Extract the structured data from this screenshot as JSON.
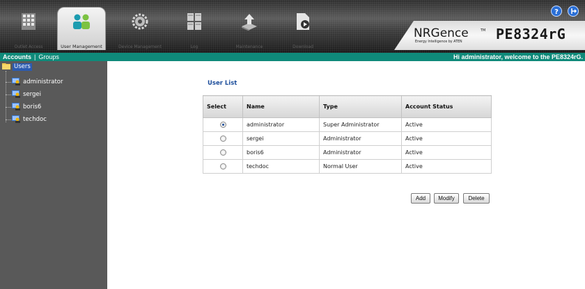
{
  "nav": {
    "tabs": [
      {
        "label": "Outlet Access",
        "icon": "outlet-grid-icon",
        "active": false
      },
      {
        "label": "User Management",
        "icon": "users-icon",
        "active": true
      },
      {
        "label": "Device Management",
        "icon": "gear-icon",
        "active": false
      },
      {
        "label": "Log",
        "icon": "log-icon",
        "active": false
      },
      {
        "label": "Maintenance",
        "icon": "upload-icon",
        "active": false
      },
      {
        "label": "Download",
        "icon": "download-icon",
        "active": false
      }
    ]
  },
  "brand": {
    "logo_text": "NRGence",
    "logo_tm": "TM",
    "logo_tagline": "Energy Intelligence by ATEN",
    "model": "PE8324rG"
  },
  "top_icons": [
    "help-icon",
    "logout-icon"
  ],
  "subnav": {
    "tabs": [
      "Accounts",
      "Groups"
    ],
    "separator": "|",
    "welcome": "Hi administrator, welcome to the PE8324rG."
  },
  "sidebar": {
    "root": "Users",
    "items": [
      "administrator",
      "sergei",
      "boris6",
      "techdoc"
    ]
  },
  "main": {
    "title": "User List",
    "table": {
      "headers": [
        "Select",
        "Name",
        "Type",
        "Account Status"
      ],
      "rows": [
        {
          "name": "administrator",
          "type": "Super Administrator",
          "status": "Active",
          "selected": true
        },
        {
          "name": "sergei",
          "type": "Administrator",
          "status": "Active",
          "selected": false
        },
        {
          "name": "boris6",
          "type": "Administrator",
          "status": "Active",
          "selected": false
        },
        {
          "name": "techdoc",
          "type": "Normal User",
          "status": "Active",
          "selected": false
        }
      ]
    },
    "buttons": {
      "add": "Add",
      "modify": "Modify",
      "delete": "Delete"
    }
  },
  "colors": {
    "accent_bar": "#0f8a7a",
    "sidebar_bg": "#595959",
    "title_blue": "#1e4f9c"
  }
}
